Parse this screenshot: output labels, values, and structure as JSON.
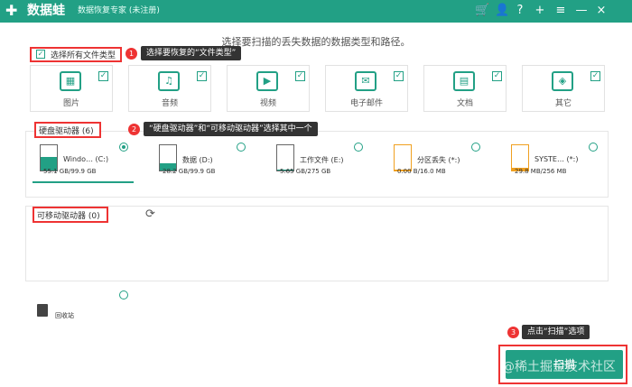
{
  "app": {
    "brand": "数据蛙",
    "subtitle": "数据恢复专家 (未注册)"
  },
  "titlebar_icons": [
    {
      "name": "cart-icon",
      "glyph": "🛒"
    },
    {
      "name": "user-icon",
      "glyph": "👤"
    },
    {
      "name": "help-icon",
      "glyph": "?"
    },
    {
      "name": "plus-icon",
      "glyph": "+"
    },
    {
      "name": "menu-icon",
      "glyph": "≡"
    },
    {
      "name": "minimize-icon",
      "glyph": "—"
    },
    {
      "name": "close-icon",
      "glyph": "×"
    }
  ],
  "heading": "选择要扫描的丢失数据的数据类型和路径。",
  "select_all_label": "选择所有文件类型",
  "callouts": [
    {
      "num": "1",
      "label": "选择要恢复的“文件类型”"
    },
    {
      "num": "2",
      "label": "“硬盘驱动器”和“可移动驱动器”选择其中一个"
    },
    {
      "num": "3",
      "label": "点击“扫描”选项"
    }
  ],
  "file_types": [
    {
      "label": "图片",
      "icon": "image-icon",
      "glyph": "▦"
    },
    {
      "label": "音频",
      "icon": "music-icon",
      "glyph": "♫"
    },
    {
      "label": "视频",
      "icon": "video-icon",
      "glyph": "▶"
    },
    {
      "label": "电子邮件",
      "icon": "email-icon",
      "glyph": "✉"
    },
    {
      "label": "文档",
      "icon": "document-icon",
      "glyph": "▤"
    },
    {
      "label": "其它",
      "icon": "other-icon",
      "glyph": "◈"
    }
  ],
  "hard_drive_section": {
    "title": "硬盘驱动器 (6)"
  },
  "drives": [
    {
      "name": "Windo… (C:)",
      "size": "55.1 GB/99.9 GB",
      "fill": 0.55,
      "color": "#22a085",
      "selected": true
    },
    {
      "name": "数据 (D:)",
      "size": "28.2 GB/99.9 GB",
      "fill": 0.28,
      "color": "#22a085",
      "selected": false
    },
    {
      "name": "工作文件 (E:)",
      "size": "5.65 GB/275 GB",
      "fill": 0.02,
      "color": "#22a085",
      "selected": false
    },
    {
      "name": "分区丢失 (*:)",
      "size": "0.00  B/16.0 MB",
      "fill": 0.0,
      "color": "#f0a020",
      "selected": false
    },
    {
      "name": "SYSTE… (*:)",
      "size": "29.8 MB/256 MB",
      "fill": 0.12,
      "color": "#f0a020",
      "selected": false
    }
  ],
  "removable_section": {
    "title": "可移动驱动器 (0)",
    "refresh_icon": "refresh-icon"
  },
  "recycle_bin": {
    "label": "回收站"
  },
  "scan_button": {
    "label": "扫描"
  },
  "watermark": "@稀土掘金技术社区"
}
